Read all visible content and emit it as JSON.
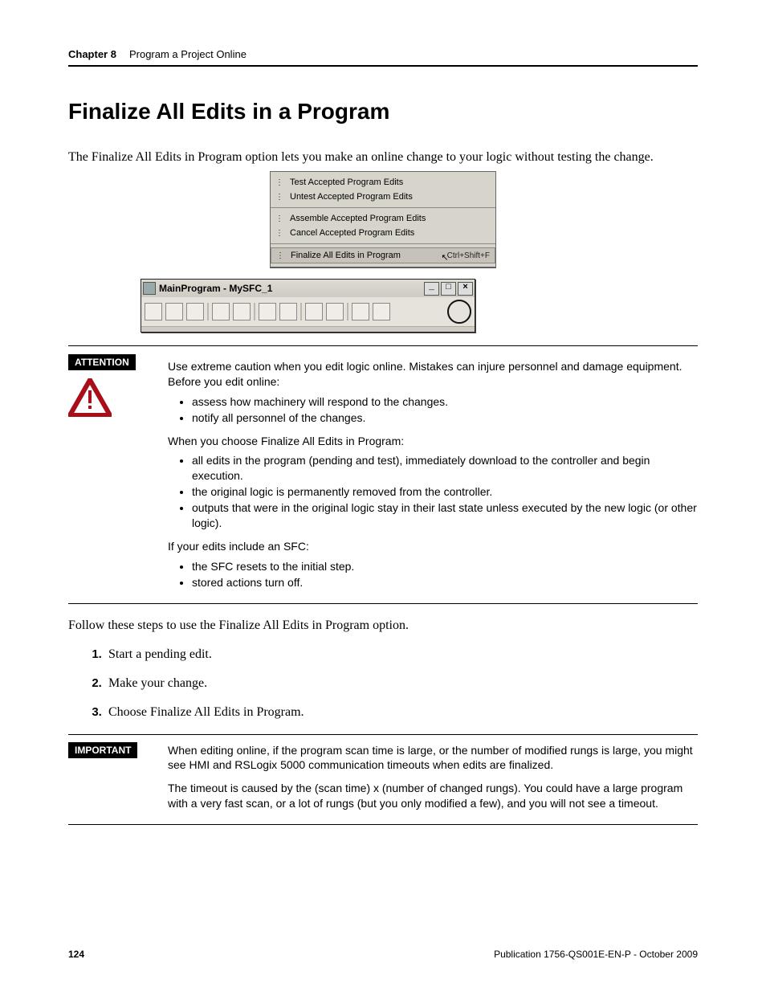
{
  "header": {
    "chapter": "Chapter 8",
    "title": "Program a Project Online"
  },
  "h1": "Finalize All Edits in a Program",
  "intro": "The Finalize All Edits in Program option lets you make an online change to your logic without testing the change.",
  "menu": {
    "items": [
      {
        "label": "Test Accepted Program Edits"
      },
      {
        "label": "Untest Accepted Program Edits"
      },
      {
        "label": "Assemble Accepted Program Edits"
      },
      {
        "label": "Cancel Accepted Program Edits"
      },
      {
        "label": "Finalize All Edits in Program",
        "shortcut": "Ctrl+Shift+F",
        "highlight": true
      }
    ]
  },
  "window": {
    "title": "MainProgram - MySFC_1"
  },
  "attention": {
    "label": "ATTENTION",
    "p1": "Use extreme caution when you edit logic online. Mistakes can injure personnel and damage equipment. Before you edit online:",
    "b1": "assess how machinery will respond to the changes.",
    "b2": "notify all personnel of the changes.",
    "p2": "When you choose Finalize All Edits in Program:",
    "b3": "all edits in the program (pending and test), immediately download to the controller and begin execution.",
    "b4": "the original logic is permanently removed from the controller.",
    "b5": "outputs that were in the original logic stay in their last state unless executed by the new logic (or other logic).",
    "p3": "If your edits include an SFC:",
    "b6": "the SFC resets to the initial step.",
    "b7": "stored actions turn off."
  },
  "steps_lead": "Follow these steps to use the Finalize All Edits in Program option.",
  "steps": {
    "s1": "Start a pending edit.",
    "s2": "Make your change.",
    "s3": "Choose Finalize All Edits in Program."
  },
  "important": {
    "label": "IMPORTANT",
    "p1": "When editing online, if the program scan time is large, or the number of modified rungs is large, you might see HMI and RSLogix 5000 communication timeouts when edits are finalized.",
    "p2": "The timeout is caused by the (scan time) x (number of changed rungs). You could have a large program with a very fast scan, or a lot of rungs (but you only modified a few), and you will not see a timeout."
  },
  "footer": {
    "page": "124",
    "pub": "Publication 1756-QS001E-EN-P - October 2009"
  }
}
